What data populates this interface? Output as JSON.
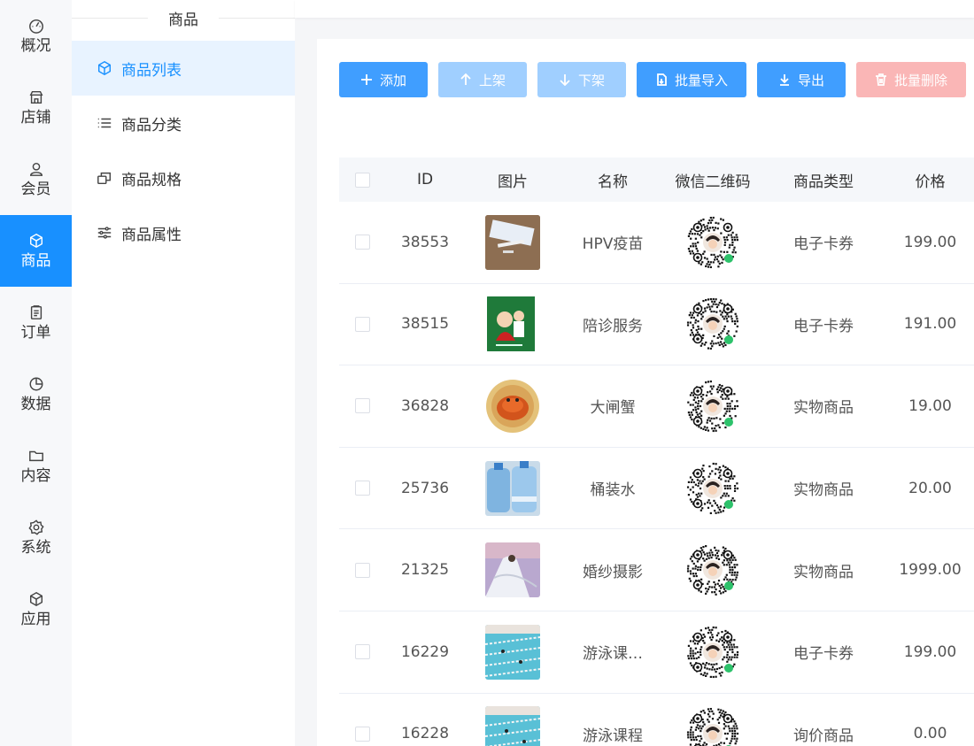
{
  "nav": {
    "items": [
      {
        "label": "概况",
        "icon": "dashboard-icon"
      },
      {
        "label": "店铺",
        "icon": "store-icon"
      },
      {
        "label": "会员",
        "icon": "user-icon"
      },
      {
        "label": "商品",
        "icon": "box-icon",
        "active": true
      },
      {
        "label": "订单",
        "icon": "clipboard-icon"
      },
      {
        "label": "数据",
        "icon": "pie-chart-icon"
      },
      {
        "label": "内容",
        "icon": "folder-icon"
      },
      {
        "label": "系统",
        "icon": "gear-icon"
      },
      {
        "label": "应用",
        "icon": "cube-icon"
      }
    ]
  },
  "sub": {
    "title": "商品",
    "items": [
      {
        "label": "商品列表",
        "icon": "cube-icon",
        "active": true
      },
      {
        "label": "商品分类",
        "icon": "list-icon"
      },
      {
        "label": "商品规格",
        "icon": "layers-icon"
      },
      {
        "label": "商品属性",
        "icon": "sliders-icon"
      }
    ]
  },
  "toolbar": {
    "add": "添加",
    "on_shelf": "上架",
    "off_shelf": "下架",
    "batch_import": "批量导入",
    "export": "导出",
    "batch_delete": "批量删除"
  },
  "table": {
    "headers": {
      "id": "ID",
      "image": "图片",
      "name": "名称",
      "qr": "微信二维码",
      "type": "商品类型",
      "price": "价格"
    },
    "rows": [
      {
        "id": "38553",
        "name": "HPV疫苗",
        "type": "电子卡券",
        "price": "199.00",
        "thumb": "vaccine"
      },
      {
        "id": "38515",
        "name": "陪诊服务",
        "type": "电子卡券",
        "price": "191.00",
        "thumb": "escort"
      },
      {
        "id": "36828",
        "name": "大闸蟹",
        "type": "实物商品",
        "price": "19.00",
        "thumb": "crab"
      },
      {
        "id": "25736",
        "name": "桶装水",
        "type": "实物商品",
        "price": "20.00",
        "thumb": "water"
      },
      {
        "id": "21325",
        "name": "婚纱摄影",
        "type": "实物商品",
        "price": "1999.00",
        "thumb": "wedding"
      },
      {
        "id": "16229",
        "name": "游泳课…",
        "type": "电子卡券",
        "price": "199.00",
        "thumb": "pool"
      },
      {
        "id": "16228",
        "name": "游泳课程",
        "type": "询价商品",
        "price": "0.00",
        "thumb": "pool"
      }
    ]
  },
  "colors": {
    "primary": "#409eff",
    "primary_disabled": "#a0cfff",
    "danger_disabled": "#fab6b6",
    "nav_active": "#1890ff"
  }
}
